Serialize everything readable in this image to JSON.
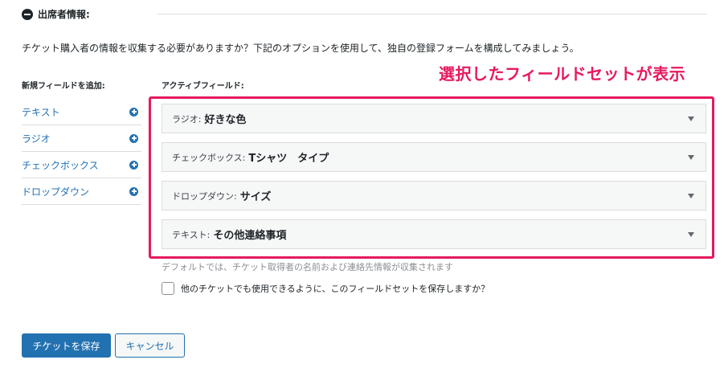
{
  "section": {
    "title": "出席者情報:",
    "intro": "チケット購入者の情報を収集する必要がありますか？下記のオプションを使用して、独自の登録フォームを構成してみましょう。"
  },
  "callout": "選択したフィールドセットが表示",
  "add_fields": {
    "label": "新規フィールドを追加:",
    "items": [
      {
        "label": "テキスト",
        "icon": "plus-circle-icon"
      },
      {
        "label": "ラジオ",
        "icon": "plus-circle-icon"
      },
      {
        "label": "チェックボックス",
        "icon": "plus-circle-icon"
      },
      {
        "label": "ドロップダウン",
        "icon": "plus-circle-icon"
      }
    ]
  },
  "active_fields": {
    "label": "アクティブフィールド:",
    "items": [
      {
        "type": "ラジオ:",
        "name": "好きな色"
      },
      {
        "type": "チェックボックス:",
        "name": "Tシャツ　タイプ"
      },
      {
        "type": "ドロップダウン:",
        "name": "サイズ"
      },
      {
        "type": "テキスト:",
        "name": "その他連絡事項"
      }
    ]
  },
  "default_note": "デフォルトでは、チケット取得者の名前および連絡先情報が収集されます",
  "save_fieldset": {
    "label": "他のチケットでも使用できるように、このフィールドセットを保存しますか？",
    "checked": false
  },
  "buttons": {
    "save": "チケットを保存",
    "cancel": "キャンセル"
  },
  "colors": {
    "accent": "#2271b1",
    "highlight": "#e6195f"
  }
}
